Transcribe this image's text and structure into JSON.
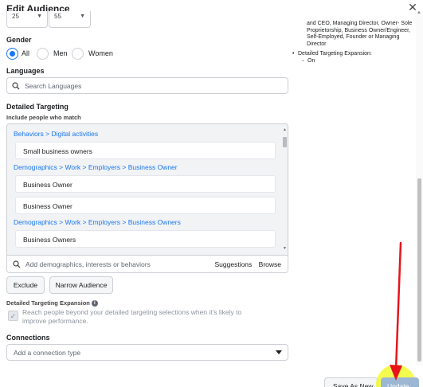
{
  "header": {
    "title": "Edit Audience",
    "close_label": "✕"
  },
  "age": {
    "min": "25",
    "max": "55"
  },
  "gender": {
    "label": "Gender",
    "options": [
      "All",
      "Men",
      "Women"
    ],
    "selected": "All"
  },
  "languages": {
    "label": "Languages",
    "placeholder": "Search Languages"
  },
  "detailed_targeting": {
    "label": "Detailed Targeting",
    "include_label": "Include people who match",
    "groups": [
      {
        "path": [
          "Behaviors",
          "Digital activities"
        ],
        "items": [
          "Small business owners"
        ]
      },
      {
        "path": [
          "Demographics",
          "Work",
          "Employers",
          "Business Owner"
        ],
        "items": [
          "Business Owner",
          "Business Owner"
        ]
      },
      {
        "path": [
          "Demographics",
          "Work",
          "Employers",
          "Business Owners"
        ],
        "items": [
          "Business Owners"
        ]
      }
    ],
    "search_placeholder": "Add demographics, interests or behaviors",
    "suggestions_label": "Suggestions",
    "browse_label": "Browse"
  },
  "actions": {
    "exclude_label": "Exclude",
    "narrow_label": "Narrow Audience"
  },
  "expansion": {
    "label": "Detailed Targeting Expansion",
    "description": "Reach people beyond your detailed targeting selections when it's likely to improve performance.",
    "checked": true
  },
  "connections": {
    "label": "Connections",
    "placeholder": "Add a connection type"
  },
  "summary": {
    "lines": [
      "and CEO, Managing Director, Owner- Sole",
      "Proprietorship, Business Owner/Engineer,",
      "Self-Employed, Founder or Managing",
      "Director"
    ],
    "expansion_label": "Detailed Targeting Expansion:",
    "expansion_value": "On"
  },
  "footer": {
    "save_label": "Save As New",
    "update_label": "Update"
  },
  "colors": {
    "accent": "#1877f2",
    "annotation_arrow": "#e8141b",
    "highlight": "#f0fa14"
  }
}
